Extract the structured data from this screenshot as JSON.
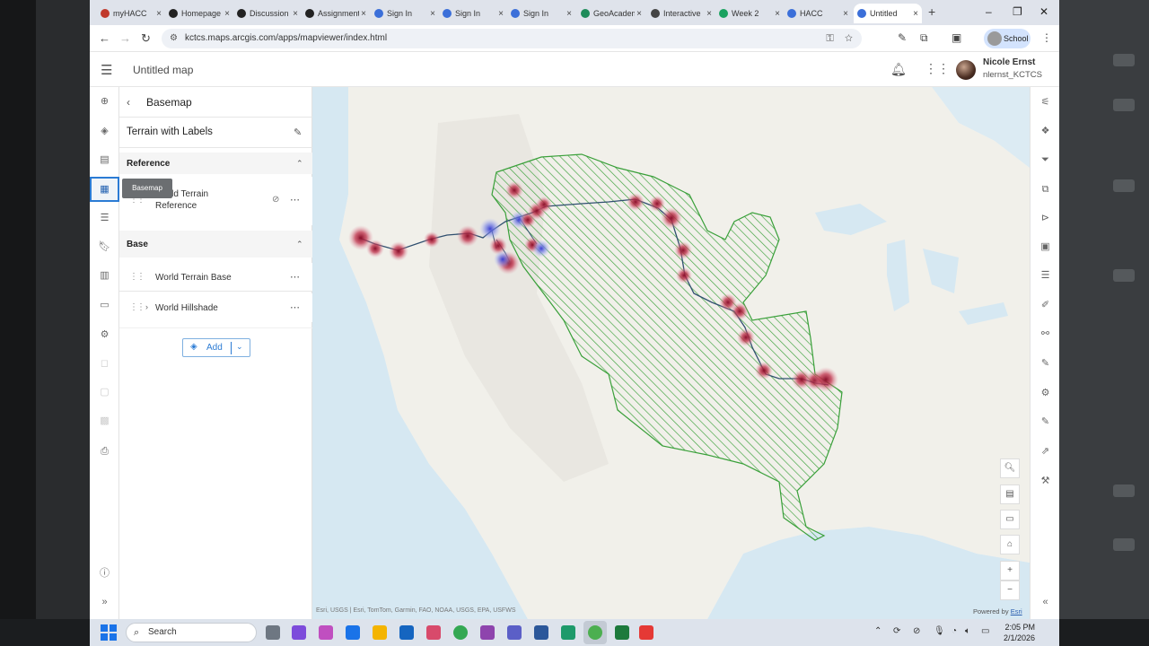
{
  "browser": {
    "tabs": [
      {
        "label": "myHACC",
        "icon_color": "#c0392b"
      },
      {
        "label": "Homepage",
        "icon_color": "#222222"
      },
      {
        "label": "Discussion",
        "icon_color": "#222222"
      },
      {
        "label": "Assignment",
        "icon_color": "#222222"
      },
      {
        "label": "Sign In",
        "icon_color": "#3b6fd9"
      },
      {
        "label": "Sign In",
        "icon_color": "#3b6fd9"
      },
      {
        "label": "Sign In",
        "icon_color": "#3b6fd9"
      },
      {
        "label": "GeoAcademy",
        "icon_color": "#1e8c5a"
      },
      {
        "label": "Interactive",
        "icon_color": "#444444"
      },
      {
        "label": "Week 2",
        "icon_color": "#1aa260"
      },
      {
        "label": "HACC",
        "icon_color": "#3b6fd9"
      },
      {
        "label": "Untitled",
        "icon_color": "#3b6fd9"
      }
    ],
    "url": "kctcs.maps.arcgis.com/apps/mapviewer/index.html",
    "profile_label": "School"
  },
  "app": {
    "map_title": "Untitled map",
    "user_name": "Nicole Ernst",
    "user_id": "nlernst_KCTCS"
  },
  "tooltip": "Basemap",
  "panel": {
    "title": "Basemap",
    "basemap_name": "Terrain with Labels",
    "reference_header": "Reference",
    "reference_layers": [
      "World Terrain Reference"
    ],
    "base_header": "Base",
    "base_layers": [
      "World Terrain Base",
      "World Hillshade"
    ],
    "add_label": "Add"
  },
  "map": {
    "attribution": "Esri, USGS | Esri, TomTom, Garmin, FAO, NOAA, USGS, EPA, USFWS",
    "powered_by": "Powered by",
    "powered_by_link": "Esri",
    "colors": {
      "hatch": "#3aa03a",
      "hotspot": "#b0203a",
      "river": "#2f4f6f",
      "water": "#d6e8f2"
    }
  },
  "taskbar": {
    "search_placeholder": "Search",
    "time": "2:05 PM",
    "date": "2/1/2026"
  }
}
